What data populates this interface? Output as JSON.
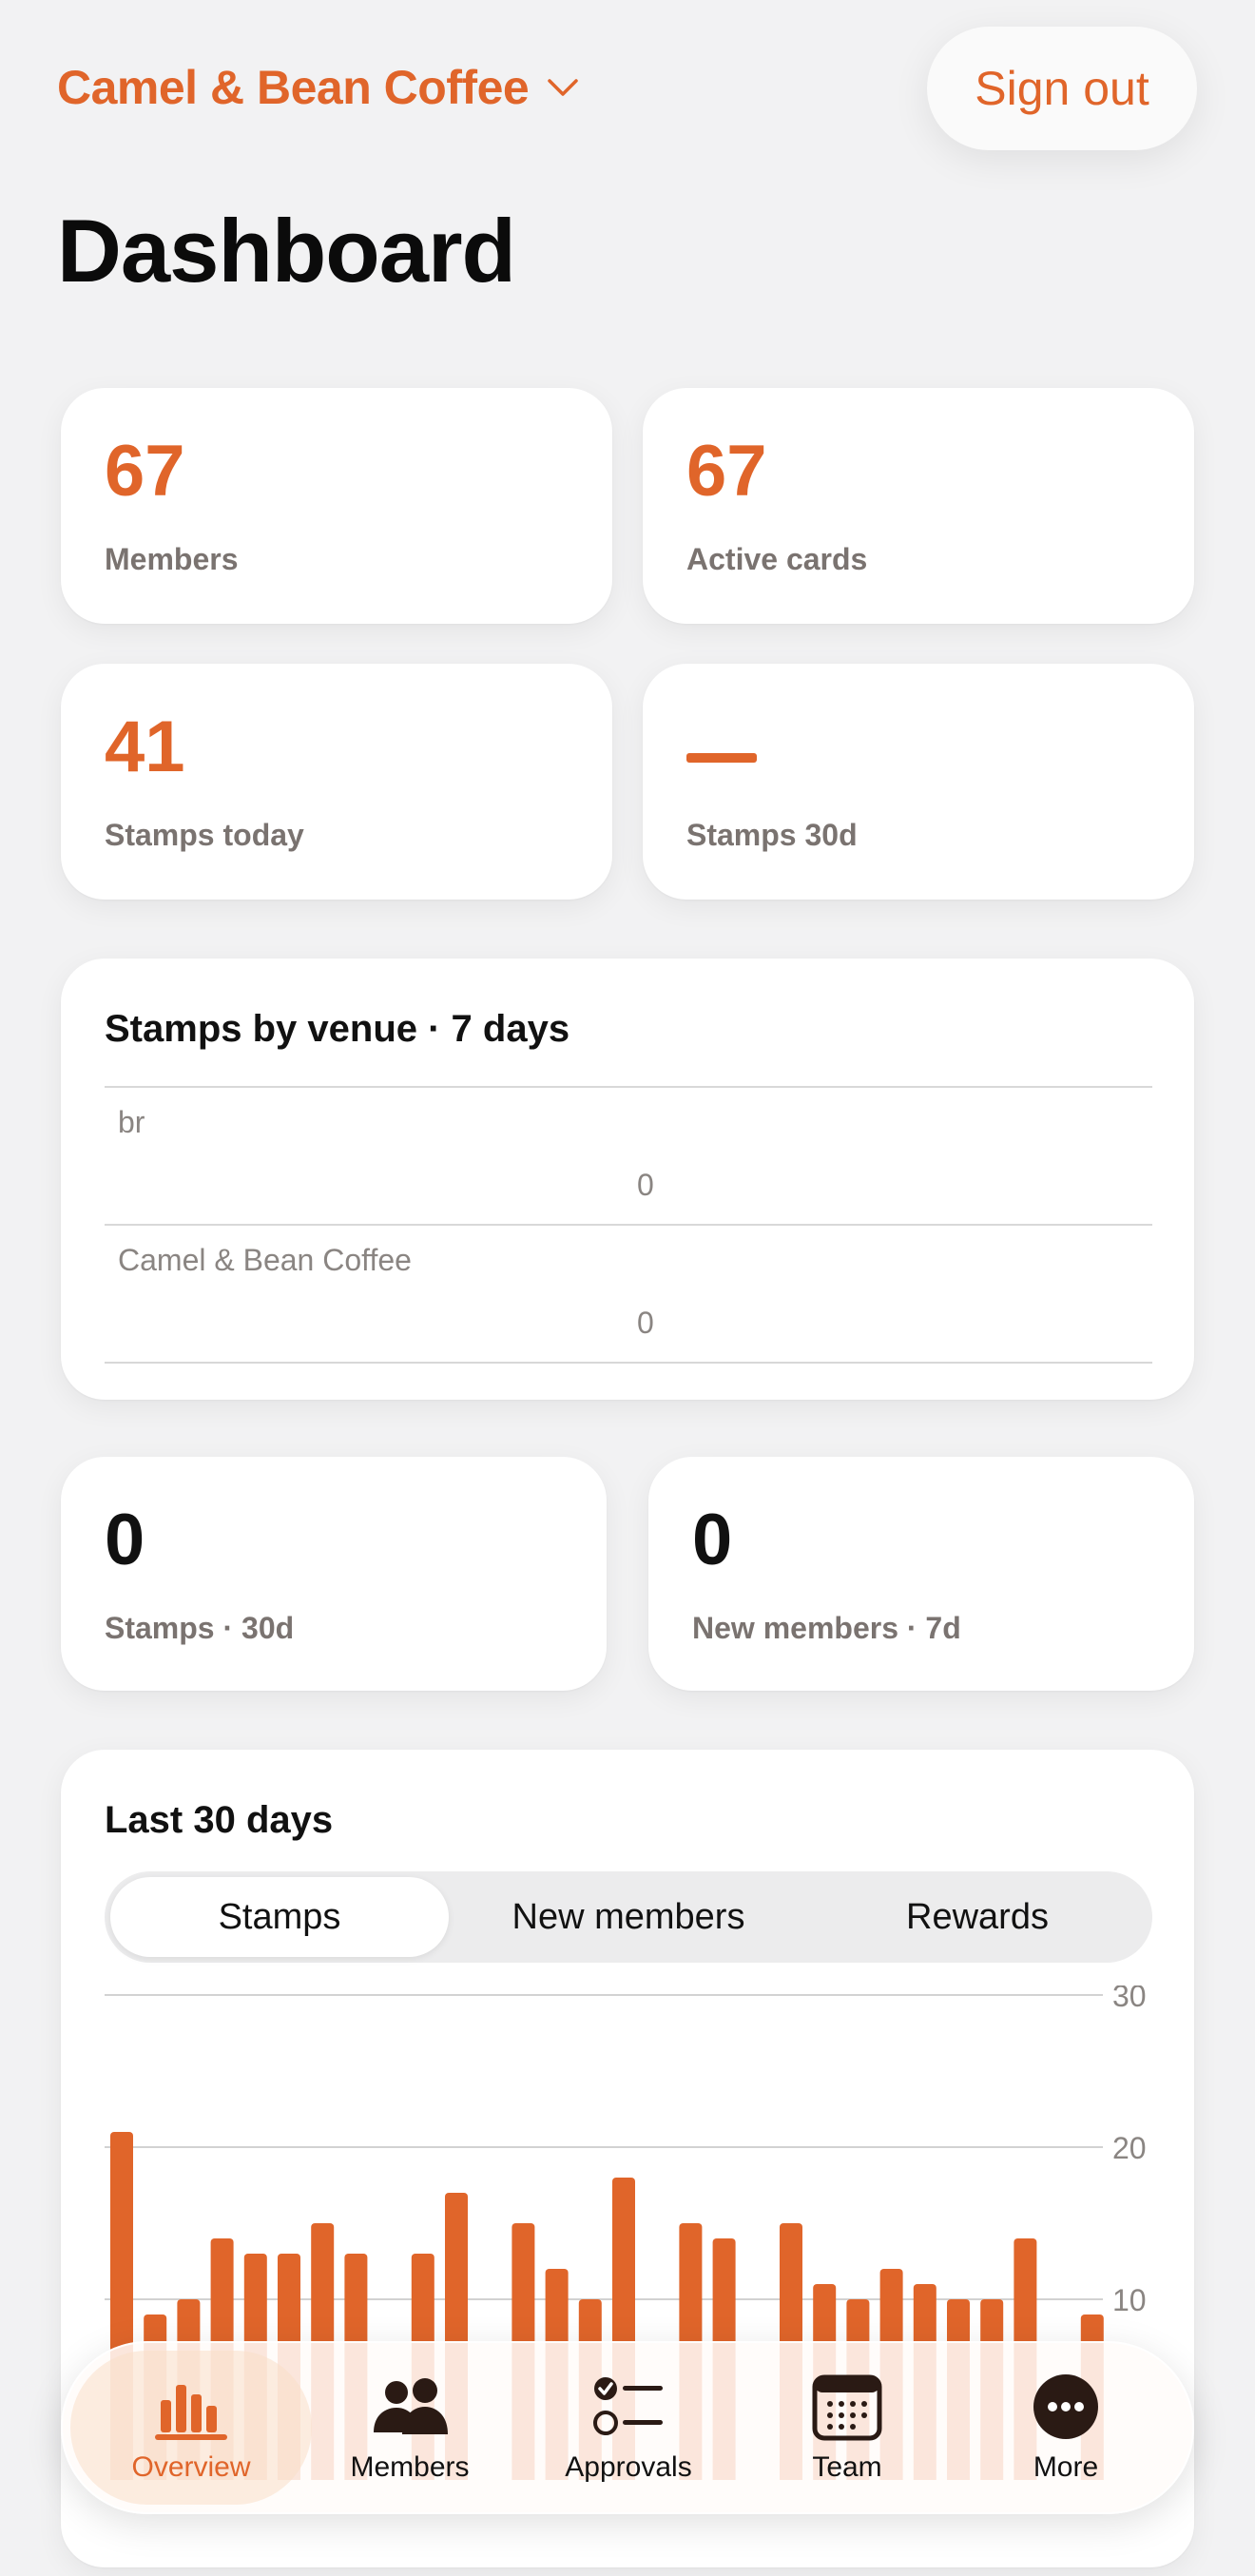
{
  "header": {
    "venue": "Camel & Bean Coffee",
    "sign_out": "Sign out"
  },
  "page_title": "Dashboard",
  "stats": [
    {
      "value": "67",
      "label": "Members"
    },
    {
      "value": "67",
      "label": "Active cards"
    },
    {
      "value": "41",
      "label": "Stamps today"
    },
    {
      "value": "—",
      "label": "Stamps 30d"
    }
  ],
  "venue_card": {
    "title": "Stamps by venue · 7 days",
    "rows": [
      {
        "name": "br",
        "count": "0"
      },
      {
        "name": "Camel & Bean Coffee",
        "count": "0"
      }
    ]
  },
  "summary": [
    {
      "value": "0",
      "label": "Stamps · 30d"
    },
    {
      "value": "0",
      "label": "New members · 7d"
    }
  ],
  "trend_card": {
    "title": "Last 30 days",
    "segments": [
      "Stamps",
      "New members",
      "Rewards"
    ],
    "selected_segment": "Stamps"
  },
  "chart_data": {
    "type": "bar",
    "title": "Last 30 days",
    "series": [
      {
        "values": [
          21,
          9,
          10,
          14,
          13,
          13,
          15,
          13,
          0,
          13,
          17,
          0,
          15,
          12,
          10,
          18,
          0,
          15,
          14,
          0,
          15,
          11,
          10,
          12,
          11,
          10,
          10,
          14,
          0,
          9
        ]
      }
    ],
    "yticks": [
      "30",
      "20",
      "10"
    ],
    "ylim": [
      0,
      30
    ],
    "grid": true,
    "bar_color": "#e0652a"
  },
  "tabbar": [
    {
      "label": "Overview",
      "icon": "bar-chart-icon",
      "active": true
    },
    {
      "label": "Members",
      "icon": "people-icon",
      "active": false
    },
    {
      "label": "Approvals",
      "icon": "checklist-icon",
      "active": false
    },
    {
      "label": "Team",
      "icon": "calendar-icon",
      "active": false
    },
    {
      "label": "More",
      "icon": "more-icon",
      "active": false
    }
  ],
  "colors": {
    "accent": "#e0652a",
    "background": "#f2f2f3"
  }
}
